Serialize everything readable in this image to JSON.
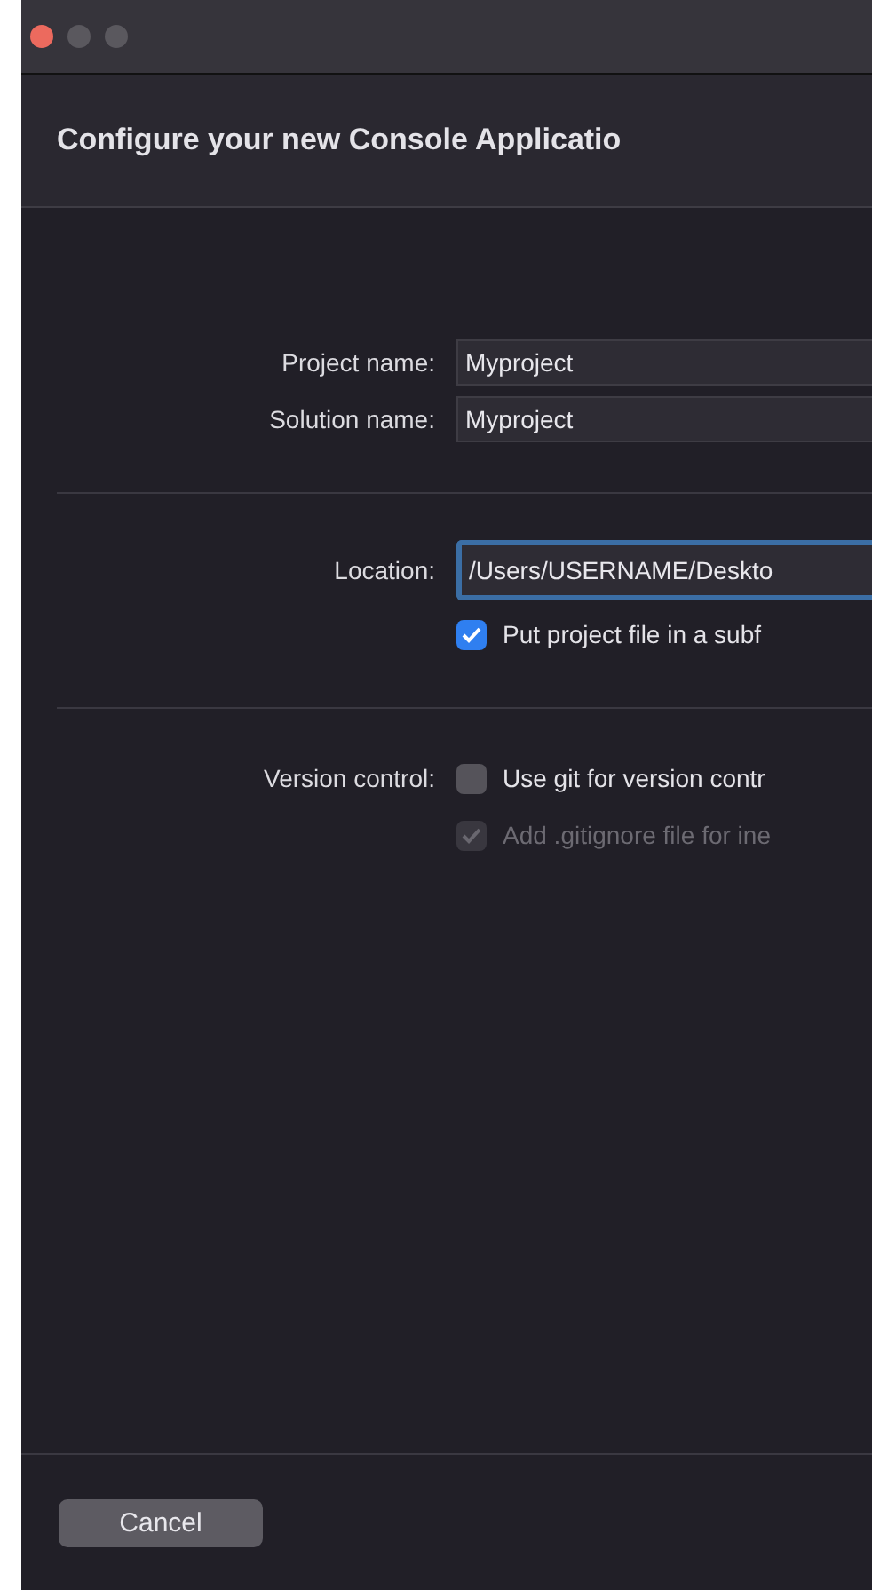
{
  "window": {
    "title": "Configure your new Console Applicatio",
    "controls": [
      {
        "kind": "close"
      },
      {
        "kind": "minimize"
      },
      {
        "kind": "zoom"
      }
    ]
  },
  "sections": [
    {
      "rows": [
        {
          "kind": "field",
          "label": "Project name:",
          "value": "Myproject",
          "focused": false
        },
        {
          "kind": "field",
          "label": "Solution name:",
          "value": "Myproject",
          "focused": false
        }
      ]
    },
    {
      "rows": [
        {
          "kind": "field",
          "label": "Location:",
          "value": "/Users/USERNAME/Deskto",
          "focused": true
        },
        {
          "kind": "checkbox",
          "text": "Put project file in a subf",
          "checked": true,
          "disabled": false
        }
      ]
    },
    {
      "rows": [
        {
          "kind": "checkbox",
          "label": "Version control:",
          "text": "Use git for version contr",
          "checked": false,
          "disabled": false
        },
        {
          "kind": "checkbox",
          "text": "Add .gitignore file for ine",
          "checked": true,
          "disabled": true
        }
      ]
    }
  ],
  "buttons": [
    {
      "label": "Cancel"
    }
  ]
}
